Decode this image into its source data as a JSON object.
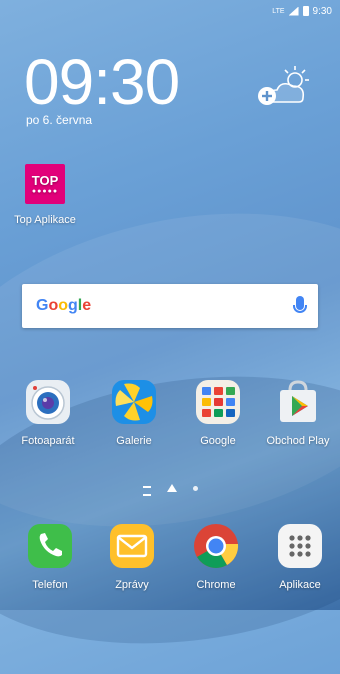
{
  "status_bar": {
    "network": "LTE",
    "time": "9:30"
  },
  "clock": {
    "time": "09:30",
    "date": "po 6. června"
  },
  "widgets": {
    "top_app": {
      "logo_text": "TOP",
      "label": "Top Aplikace"
    }
  },
  "search_bar": {
    "logo": "Google"
  },
  "apps": [
    {
      "label": "Fotoaparát"
    },
    {
      "label": "Galerie"
    },
    {
      "label": "Google"
    },
    {
      "label": "Obchod Play"
    }
  ],
  "dock": [
    {
      "label": "Telefon"
    },
    {
      "label": "Zprávy"
    },
    {
      "label": "Chrome"
    },
    {
      "label": "Aplikace"
    }
  ]
}
